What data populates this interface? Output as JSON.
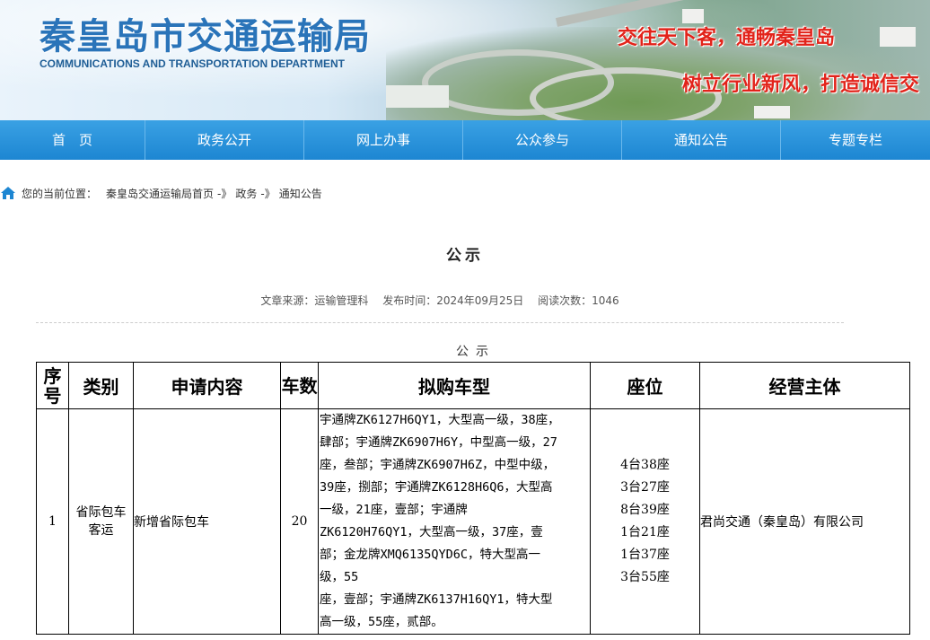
{
  "header": {
    "title_cn": "秦皇岛市交通运输局",
    "title_en": "COMMUNICATIONS AND TRANSPORTATION DEPARTMENT",
    "slogan_1": "交往天下客，通畅秦皇岛",
    "slogan_2": "树立行业新风，打造诚信交"
  },
  "nav": {
    "items": [
      "首　页",
      "政务公开",
      "网上办事",
      "公众参与",
      "通知公告",
      "专题专栏"
    ]
  },
  "breadcrumb": {
    "prefix": "您的当前位置：",
    "items": [
      "秦皇岛交通运输局首页",
      "政务",
      "通知公告"
    ],
    "separator": "-》"
  },
  "article": {
    "title": "公示",
    "meta": {
      "source": "文章来源：运输管理科",
      "publish": "发布时间：2024年09月25日",
      "views": "阅读次数：1046"
    },
    "subtitle": "公示"
  },
  "table": {
    "headers": [
      "序号",
      "类别",
      "申请内容",
      "车数",
      "拟购车型",
      "座位",
      "经营主体"
    ],
    "rows": [
      {
        "no": "1",
        "category": "省际包车客运",
        "content": "新增省际包车",
        "count": "20",
        "models_lines": [
          "宇通牌ZK6127H6QY1，大型高一级，38座，",
          "肆部；宇通牌ZK6907H6Y，中型高一级，27",
          "座，叁部；宇通牌ZK6907H6Z，中型中级，",
          "39座，捌部；宇通牌ZK6128H6Q6，大型高",
          "一级，21座，壹部；宇通牌",
          "ZK6120H76QY1，大型高一级，37座，壹",
          "部；金龙牌XMQ6135QYD6C，特大型高一",
          "级，55",
          "座，壹部；宇通牌ZK6137H16QY1，特大型",
          "高一级，55座，贰部。"
        ],
        "seats": [
          "4台38座",
          "3台27座",
          "8台39座",
          "1台21座",
          "1台37座",
          "3台55座"
        ],
        "operator": "君尚交通（秦皇岛）有限公司"
      }
    ]
  }
}
